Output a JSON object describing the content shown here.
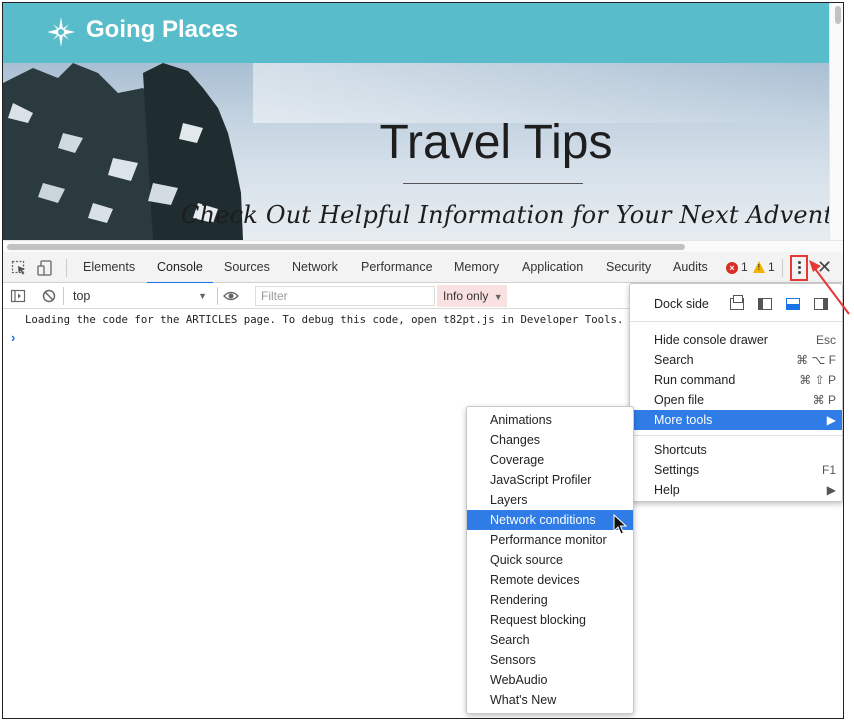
{
  "site": {
    "title": "Going Places",
    "hero_title": "Travel Tips",
    "hero_subtitle": "Check Out Helpful Information for Your Next Adventure"
  },
  "devtools": {
    "tabs": [
      "Elements",
      "Console",
      "Sources",
      "Network",
      "Performance",
      "Memory",
      "Application",
      "Security",
      "Audits"
    ],
    "active_tab": "Console",
    "error_count": "1",
    "warning_count": "1",
    "context": "top",
    "filter_placeholder": "Filter",
    "log_level": "Info only",
    "console_message": "Loading the code for the ARTICLES page. To debug this code, open t82pt.js in Developer Tools.",
    "prompt_symbol": "›"
  },
  "main_menu": {
    "dock_side_label": "Dock side",
    "items": [
      {
        "label": "Hide console drawer",
        "shortcut": "Esc"
      },
      {
        "label": "Search",
        "shortcut": "⌘ ⌥ F"
      },
      {
        "label": "Run command",
        "shortcut": "⌘ ⇧ P"
      },
      {
        "label": "Open file",
        "shortcut": "⌘ P"
      },
      {
        "label": "More tools",
        "shortcut": "▶"
      },
      {
        "label": "Shortcuts",
        "shortcut": ""
      },
      {
        "label": "Settings",
        "shortcut": "F1"
      },
      {
        "label": "Help",
        "shortcut": "▶"
      }
    ],
    "highlighted": "More tools"
  },
  "more_tools_menu": {
    "items": [
      "Animations",
      "Changes",
      "Coverage",
      "JavaScript Profiler",
      "Layers",
      "Network conditions",
      "Performance monitor",
      "Quick source",
      "Remote devices",
      "Rendering",
      "Request blocking",
      "Search",
      "Sensors",
      "WebAudio",
      "What's New"
    ],
    "highlighted": "Network conditions"
  },
  "colors": {
    "header_teal": "#58bccb",
    "highlight_blue": "#2f7ce6",
    "annotation_red": "#e53935"
  }
}
